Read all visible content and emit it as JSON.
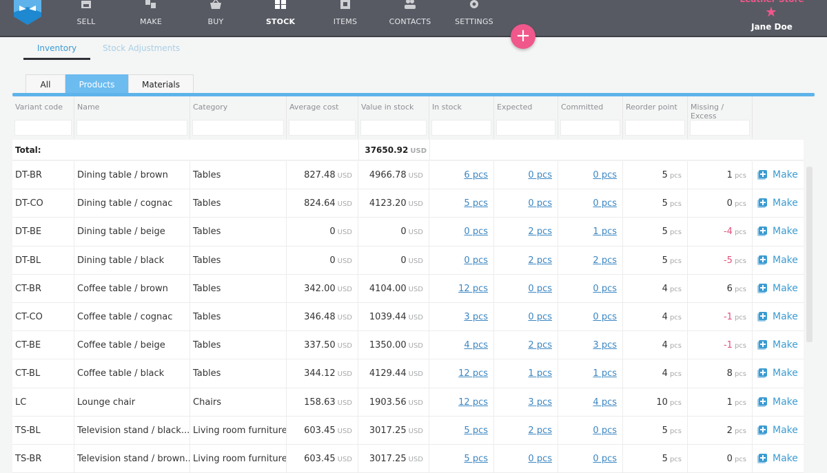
{
  "topbar": {
    "nav": [
      {
        "label": "SELL",
        "icon": "shop-icon",
        "active": false
      },
      {
        "label": "MAKE",
        "icon": "make-icon",
        "active": false
      },
      {
        "label": "BUY",
        "icon": "basket-icon",
        "active": false
      },
      {
        "label": "STOCK",
        "icon": "boxes-icon",
        "active": true
      },
      {
        "label": "ITEMS",
        "icon": "items-icon",
        "active": false
      },
      {
        "label": "CONTACTS",
        "icon": "contacts-icon",
        "active": false
      },
      {
        "label": "SETTINGS",
        "icon": "gear-icon",
        "active": false
      }
    ],
    "add_button": "+",
    "store_name": "Leather Store",
    "star": "★",
    "user_name": "Jane Doe",
    "accent_color": "#f0578b"
  },
  "subtabs": {
    "inventory": "Inventory",
    "stock_adjustments": "Stock Adjustments"
  },
  "filter_tabs": {
    "all": "All",
    "products": "Products",
    "materials": "Materials",
    "selected": "Products"
  },
  "table": {
    "columns": [
      "Variant code",
      "Name",
      "Category",
      "Average cost",
      "Value in stock",
      "In stock",
      "Expected",
      "Committed",
      "Reorder point",
      "Missing / Excess"
    ],
    "total_label": "Total:",
    "total_value": "37650.92",
    "currency": "USD",
    "unit": "pcs",
    "make_label": "Make",
    "rows": [
      {
        "code": "DT-BR",
        "name": "Dining table / brown",
        "category": "Tables",
        "avg_cost": "827.48",
        "value": "4966.78",
        "in_stock": "6 pcs",
        "expected": "0 pcs",
        "committed": "0 pcs",
        "reorder": "5",
        "missing": "1",
        "negative": false
      },
      {
        "code": "DT-CO",
        "name": "Dining table / cognac",
        "category": "Tables",
        "avg_cost": "824.64",
        "value": "4123.20",
        "in_stock": "5 pcs",
        "expected": "0 pcs",
        "committed": "0 pcs",
        "reorder": "5",
        "missing": "0",
        "negative": false
      },
      {
        "code": "DT-BE",
        "name": "Dining table / beige",
        "category": "Tables",
        "avg_cost": "0",
        "value": "0",
        "in_stock": "0 pcs",
        "expected": "2 pcs",
        "committed": "1 pcs",
        "reorder": "5",
        "missing": "-4",
        "negative": true
      },
      {
        "code": "DT-BL",
        "name": "Dining table / black",
        "category": "Tables",
        "avg_cost": "0",
        "value": "0",
        "in_stock": "0 pcs",
        "expected": "2 pcs",
        "committed": "2 pcs",
        "reorder": "5",
        "missing": "-5",
        "negative": true
      },
      {
        "code": "CT-BR",
        "name": "Coffee table / brown",
        "category": "Tables",
        "avg_cost": "342.00",
        "value": "4104.00",
        "in_stock": "12 pcs",
        "expected": "0 pcs",
        "committed": "0 pcs",
        "reorder": "4",
        "missing": "6",
        "negative": false
      },
      {
        "code": "CT-CO",
        "name": "Coffee table / cognac",
        "category": "Tables",
        "avg_cost": "346.48",
        "value": "1039.44",
        "in_stock": "3 pcs",
        "expected": "0 pcs",
        "committed": "0 pcs",
        "reorder": "4",
        "missing": "-1",
        "negative": true
      },
      {
        "code": "CT-BE",
        "name": "Coffee table / beige",
        "category": "Tables",
        "avg_cost": "337.50",
        "value": "1350.00",
        "in_stock": "4 pcs",
        "expected": "2 pcs",
        "committed": "3 pcs",
        "reorder": "4",
        "missing": "-1",
        "negative": true
      },
      {
        "code": "CT-BL",
        "name": "Coffee table / black",
        "category": "Tables",
        "avg_cost": "344.12",
        "value": "4129.44",
        "in_stock": "12 pcs",
        "expected": "1 pcs",
        "committed": "1 pcs",
        "reorder": "4",
        "missing": "8",
        "negative": false
      },
      {
        "code": "LC",
        "name": "Lounge chair",
        "category": "Chairs",
        "avg_cost": "158.63",
        "value": "1903.56",
        "in_stock": "12 pcs",
        "expected": "3 pcs",
        "committed": "4 pcs",
        "reorder": "10",
        "missing": "1",
        "negative": false
      },
      {
        "code": "TS-BL",
        "name": "Television stand / black...",
        "category": "Living room furniture",
        "avg_cost": "603.45",
        "value": "3017.25",
        "in_stock": "5 pcs",
        "expected": "2 pcs",
        "committed": "0 pcs",
        "reorder": "5",
        "missing": "2",
        "negative": false
      },
      {
        "code": "TS-BR",
        "name": "Television stand / brown...",
        "category": "Living room furniture",
        "avg_cost": "603.45",
        "value": "3017.25",
        "in_stock": "5 pcs",
        "expected": "0 pcs",
        "committed": "0 pcs",
        "reorder": "5",
        "missing": "0",
        "negative": false
      }
    ]
  }
}
